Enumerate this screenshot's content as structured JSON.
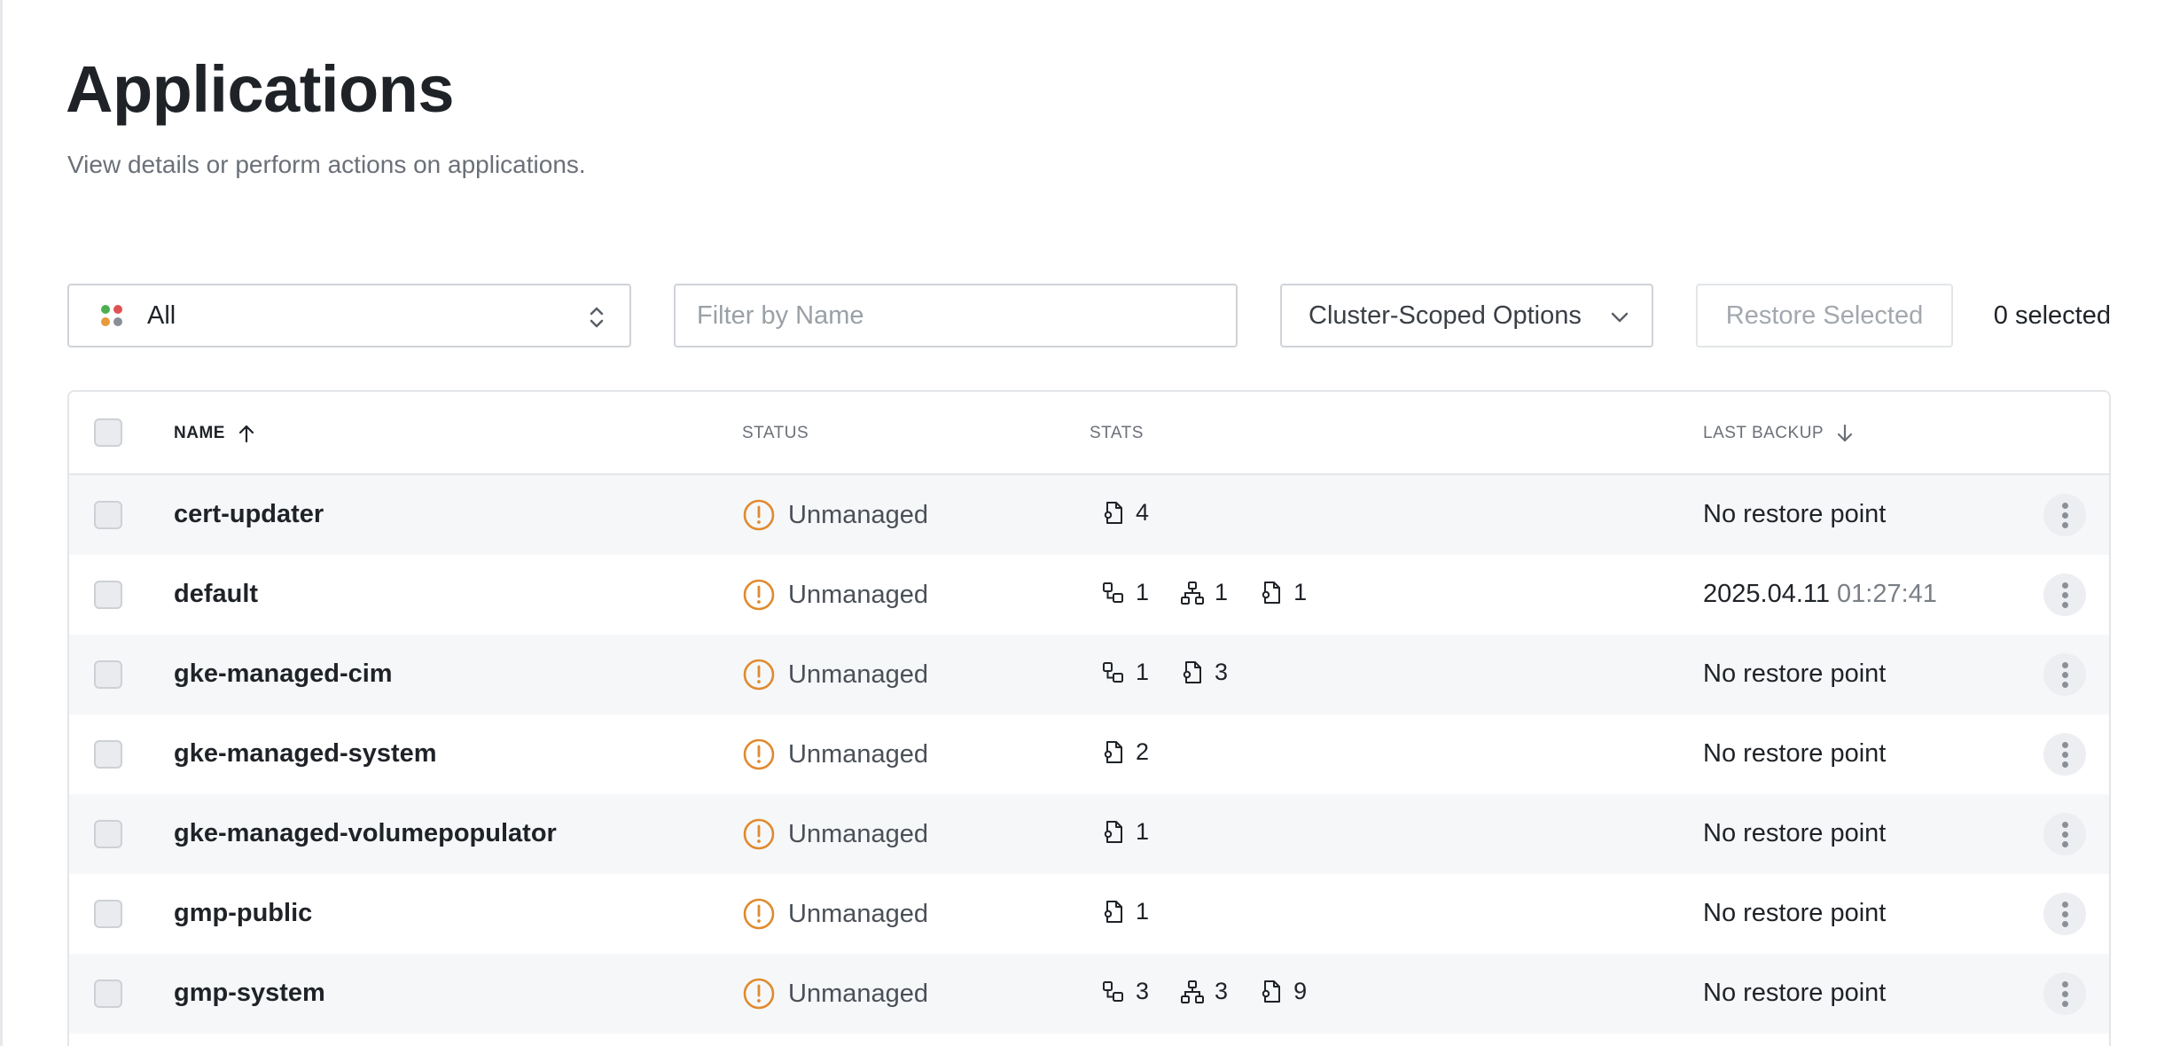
{
  "page": {
    "title": "Applications",
    "subtitle": "View details or perform actions on applications."
  },
  "toolbar": {
    "filter_select": {
      "value": "All",
      "icon": "status-dots-icon",
      "dot_colors": [
        "#4caf50",
        "#e05252",
        "#e69a3a",
        "#8a8f96"
      ]
    },
    "name_filter": {
      "placeholder": "Filter by Name",
      "value": ""
    },
    "cluster_options_label": "Cluster-Scoped Options",
    "restore_selected_label": "Restore Selected",
    "selected_count": "0 selected"
  },
  "table": {
    "columns": {
      "name": "NAME",
      "status": "STATUS",
      "stats": "STATS",
      "last_backup": "LAST BACKUP"
    },
    "rows": [
      {
        "name": "cert-updater",
        "status": "Unmanaged",
        "stats": [
          {
            "icon": "config-file-icon",
            "count": "4"
          }
        ],
        "backup_date": "No restore point",
        "backup_time": ""
      },
      {
        "name": "default",
        "status": "Unmanaged",
        "stats": [
          {
            "icon": "workload-icon",
            "count": "1"
          },
          {
            "icon": "network-icon",
            "count": "1"
          },
          {
            "icon": "config-file-icon",
            "count": "1"
          }
        ],
        "backup_date": "2025.04.11",
        "backup_time": "01:27:41"
      },
      {
        "name": "gke-managed-cim",
        "status": "Unmanaged",
        "stats": [
          {
            "icon": "workload-icon",
            "count": "1"
          },
          {
            "icon": "config-file-icon",
            "count": "3"
          }
        ],
        "backup_date": "No restore point",
        "backup_time": ""
      },
      {
        "name": "gke-managed-system",
        "status": "Unmanaged",
        "stats": [
          {
            "icon": "config-file-icon",
            "count": "2"
          }
        ],
        "backup_date": "No restore point",
        "backup_time": ""
      },
      {
        "name": "gke-managed-volumepopulator",
        "status": "Unmanaged",
        "stats": [
          {
            "icon": "config-file-icon",
            "count": "1"
          }
        ],
        "backup_date": "No restore point",
        "backup_time": ""
      },
      {
        "name": "gmp-public",
        "status": "Unmanaged",
        "stats": [
          {
            "icon": "config-file-icon",
            "count": "1"
          }
        ],
        "backup_date": "No restore point",
        "backup_time": ""
      },
      {
        "name": "gmp-system",
        "status": "Unmanaged",
        "stats": [
          {
            "icon": "workload-icon",
            "count": "3"
          },
          {
            "icon": "network-icon",
            "count": "3"
          },
          {
            "icon": "config-file-icon",
            "count": "9"
          }
        ],
        "backup_date": "No restore point",
        "backup_time": ""
      }
    ]
  },
  "colors": {
    "warning": "#e08a2e",
    "row_alt": "#f6f7f9",
    "border": "#e3e6e9"
  }
}
